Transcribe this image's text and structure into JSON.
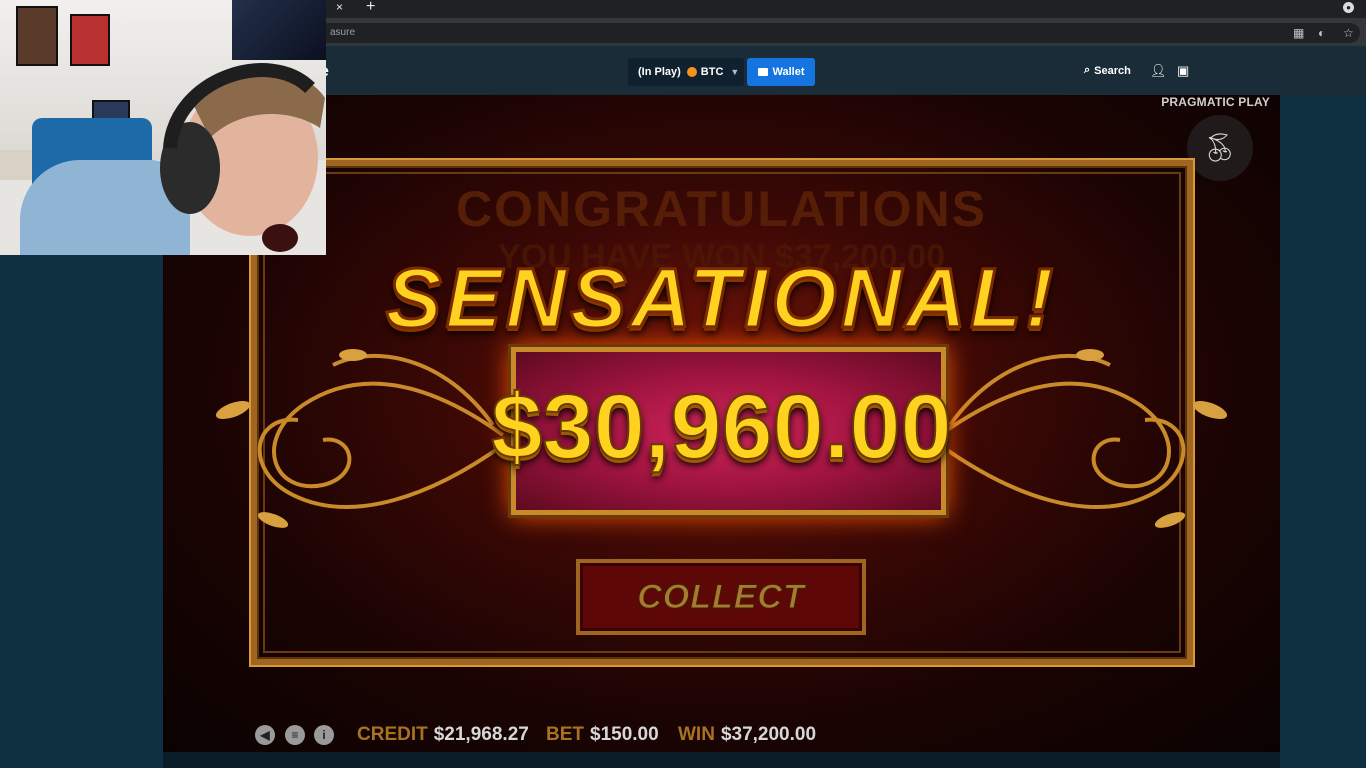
{
  "browser": {
    "tab_close": "×",
    "new_tab": "+",
    "url_fragment": "asure"
  },
  "header": {
    "logo_fragment": "e",
    "balance_label": "(In Play)",
    "currency": "BTC",
    "wallet_label": "Wallet",
    "search_label": "Search"
  },
  "game": {
    "provider": "PRAGMATIC PLAY",
    "congrats": "CONGRATULATIONS",
    "won_line": "YOU HAVE WON $37,200.00",
    "headline": "SENSATIONAL!",
    "win_amount": "$30,960.00",
    "collect_label": "COLLECT",
    "credit_label": "CREDIT",
    "credit_value": "$21,968.27",
    "bet_label": "BET",
    "bet_value": "$150.00",
    "win_label": "WIN",
    "win_value": "$37,200.00"
  },
  "colors": {
    "site_bg": "#0f3041",
    "header_bg": "#1a2c38",
    "wallet_blue": "#1475e1",
    "gold": "#ffd21f",
    "btc_orange": "#f7931a"
  },
  "icons": [
    "close-icon",
    "plus-icon",
    "qr-icon",
    "extension-icon",
    "star-icon",
    "search-icon",
    "user-icon",
    "chat-icon",
    "cherry-icon",
    "sound-icon",
    "menu-icon",
    "info-icon",
    "wallet-icon"
  ]
}
